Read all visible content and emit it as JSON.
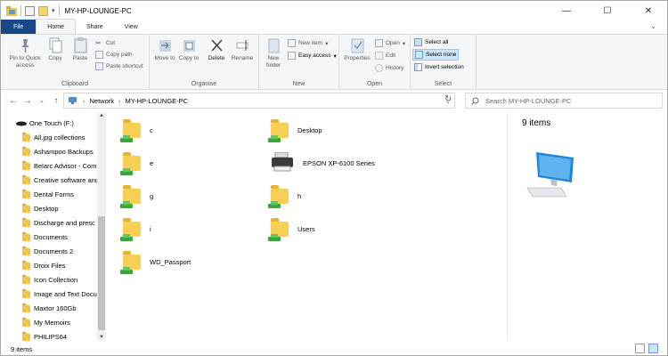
{
  "window": {
    "title": "MY-HP-LOUNGE-PC",
    "min": "—",
    "max": "☐",
    "close": "✕"
  },
  "tabs": [
    "File",
    "Home",
    "Share",
    "View"
  ],
  "ribbon": {
    "clipboard": {
      "label": "Clipboard",
      "pin": "Pin to Quick access",
      "copy": "Copy",
      "paste": "Paste",
      "cut": "Cut",
      "copy_path": "Copy path",
      "paste_shortcut": "Paste shortcut"
    },
    "organise": {
      "label": "Organise",
      "move_to": "Move to",
      "copy_to": "Copy to",
      "delete": "Delete",
      "rename": "Rename"
    },
    "new": {
      "label": "New",
      "new_folder": "New folder",
      "new_item": "New item",
      "easy_access": "Easy access"
    },
    "open": {
      "label": "Open",
      "properties": "Properties",
      "open": "Open",
      "edit": "Edit",
      "history": "History"
    },
    "select": {
      "label": "Select",
      "select_all": "Select all",
      "select_none": "Select none",
      "invert_selection": "Invert selection"
    }
  },
  "address": {
    "crumbs": [
      "Network",
      "MY-HP-LOUNGE-PC"
    ],
    "search_placeholder": "Search MY-HP-LOUNGE-PC"
  },
  "nav": {
    "drive": "One Touch (F:)",
    "folders": [
      "All.jpg collections",
      "Ashampoo Backups",
      "Belarc Advisor - Com",
      "Creative software and",
      "Dental Forms",
      "Desktop",
      "Discharge and presc",
      "Documents",
      "Documents 2",
      "Droix Files",
      "Icon Collection",
      "Image and Text Docu",
      "Maxtor 160Gb",
      "My Memoirs",
      "PHILIPS64"
    ]
  },
  "items": [
    {
      "name": "c",
      "kind": "share"
    },
    {
      "name": "Desktop",
      "kind": "share"
    },
    {
      "name": "e",
      "kind": "share"
    },
    {
      "name": "EPSON XP-6100 Series",
      "kind": "printer"
    },
    {
      "name": "g",
      "kind": "share"
    },
    {
      "name": "h",
      "kind": "share"
    },
    {
      "name": "i",
      "kind": "share"
    },
    {
      "name": "Users",
      "kind": "share"
    },
    {
      "name": "WD_Passport",
      "kind": "share"
    }
  ],
  "preview": {
    "count": "9 items"
  },
  "status": {
    "text": "9 items"
  },
  "colors": {
    "file_tab": "#19478a",
    "folder": "#f8cf55",
    "share": "#3aa53a",
    "selected": "#cde6f7"
  }
}
